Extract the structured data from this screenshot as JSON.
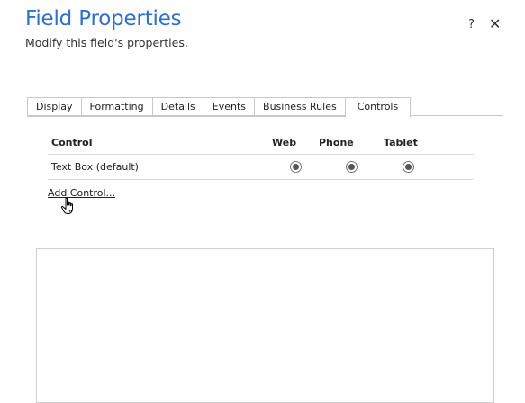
{
  "dialog": {
    "title": "Field Properties",
    "subtitle": "Modify this field's properties.",
    "help_label": "?",
    "close_label": "✕"
  },
  "tabs": [
    {
      "label": "Display"
    },
    {
      "label": "Formatting"
    },
    {
      "label": "Details"
    },
    {
      "label": "Events"
    },
    {
      "label": "Business Rules"
    },
    {
      "label": "Controls",
      "active": true
    }
  ],
  "controls_table": {
    "headers": {
      "control": "Control",
      "web": "Web",
      "phone": "Phone",
      "tablet": "Tablet"
    },
    "rows": [
      {
        "name": "Text Box (default)",
        "web": true,
        "phone": true,
        "tablet": true
      }
    ]
  },
  "add_control_label": "Add Control...",
  "cursor_icon": "hand-pointer-icon"
}
